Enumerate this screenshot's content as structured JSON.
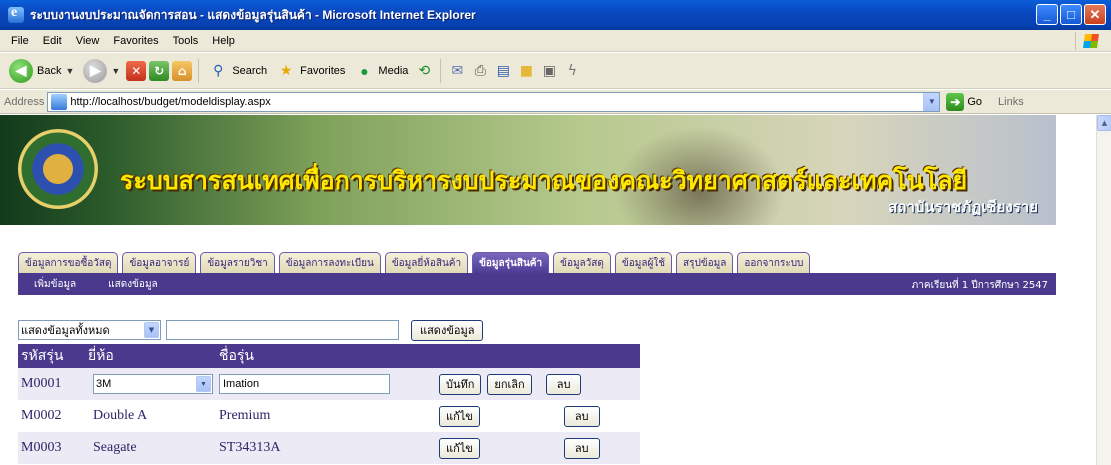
{
  "window": {
    "title": "ระบบงานงบประมาณจัดการสอน - แสดงข้อมูลรุ่นสินค้า - Microsoft Internet Explorer",
    "buttons": {
      "minimize": "_",
      "maximize": "□",
      "close": "✕"
    }
  },
  "menubar": {
    "items": [
      "File",
      "Edit",
      "View",
      "Favorites",
      "Tools",
      "Help"
    ]
  },
  "toolbar": {
    "back": "Back",
    "search": "Search",
    "favorites": "Favorites",
    "media": "Media"
  },
  "address": {
    "label": "Address",
    "url": "http://localhost/budget/modeldisplay.aspx",
    "go": "Go",
    "links": "Links"
  },
  "banner": {
    "title": "ระบบสารสนเทศเพื่อการบริหารงบประมาณของคณะวิทยาศาสตร์และเทคโนโลยี",
    "subtitle": "สถาบันราชภัฏเชียงราย"
  },
  "tabs": [
    "ข้อมูลการขอซื้อวัสดุ",
    "ข้อมูลอาจารย์",
    "ข้อมูลรายวิชา",
    "ข้อมูลการลงทะเบียน",
    "ข้อมูลยี่ห้อสินค้า",
    "ข้อมูลรุ่นสินค้า",
    "ข้อมูลวัสดุ",
    "ข้อมูลผู้ใช้",
    "สรุปข้อมูล",
    "ออกจากระบบ"
  ],
  "active_tab": "ข้อมูลรุ่นสินค้า",
  "subnav": {
    "items": [
      "เพิ่มข้อมูล",
      "แสดงข้อมูล"
    ],
    "term": "ภาคเรียนที่ 1 ปีการศึกษา 2547"
  },
  "filter": {
    "select_value": "แสดงข้อมูลทั้งหมด",
    "text_value": "",
    "button": "แสดงข้อมูล"
  },
  "table": {
    "headers": [
      "รหัสรุ่น",
      "ยี่ห้อ",
      "ชื่อรุ่น"
    ],
    "edit_row": {
      "id": "M0001",
      "brand": "3M",
      "model": "Imation",
      "save": "บันทึก",
      "cancel": "ยกเลิก",
      "delete": "ลบ"
    },
    "rows": [
      {
        "id": "M0002",
        "brand": "Double A",
        "model": "Premium",
        "edit": "แก้ไข",
        "delete": "ลบ"
      },
      {
        "id": "M0003",
        "brand": "Seagate",
        "model": "ST34313A",
        "edit": "แก้ไข",
        "delete": "ลบ"
      }
    ]
  }
}
